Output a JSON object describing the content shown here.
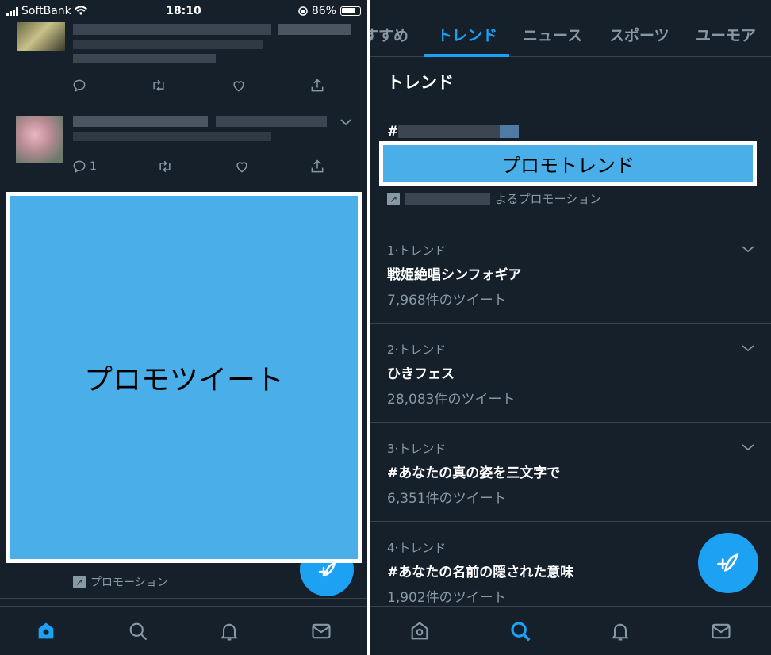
{
  "left_screen": {
    "status_bar": {
      "carrier": "SoftBank",
      "time": "18:10",
      "battery": "86%"
    },
    "tweet2": {
      "reply_count": "1"
    },
    "promo_tweet_label": "プロモツイート",
    "promotion_label": "プロモーション"
  },
  "right_screen": {
    "tabs": [
      "すすめ",
      "トレンド",
      "ニュース",
      "スポーツ",
      "ユーモア"
    ],
    "active_tab": "トレンド",
    "section_title": "トレンド",
    "promoted_trend": {
      "hash": "#",
      "label": "プロモトレンド",
      "promoted_by": "よるプロモーション"
    },
    "trends": [
      {
        "context": "1·トレンド",
        "name": "戦姫絶唱シンフォギア",
        "count": "7,968件のツイート"
      },
      {
        "context": "2·トレンド",
        "name": "ひきフェス",
        "count": "28,083件のツイート"
      },
      {
        "context": "3·トレンド",
        "name": "#あなたの真の姿を三文字で",
        "count": "6,351件のツイート"
      },
      {
        "context": "4·トレンド",
        "name": "#あなたの名前の隠された意味",
        "count": "1,902件のツイート"
      }
    ]
  },
  "colors": {
    "background": "#15202b",
    "accent": "#1da1f2",
    "promo_box": "#4aaee8",
    "secondary_text": "#8899a6",
    "divider": "#38444d"
  },
  "icons": {
    "tweet_actions": [
      "reply-icon",
      "retweet-icon",
      "like-icon",
      "share-icon"
    ],
    "tab_bar": [
      "home-icon",
      "search-icon",
      "notifications-icon",
      "messages-icon"
    ]
  }
}
